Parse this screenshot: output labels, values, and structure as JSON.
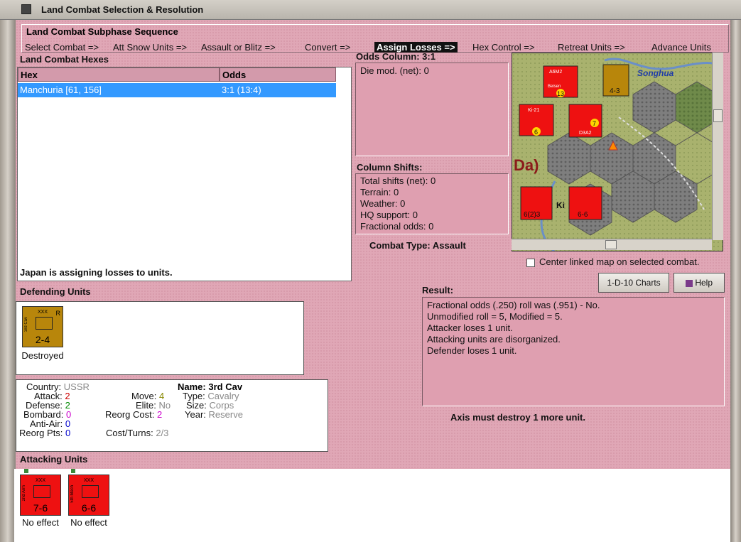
{
  "window": {
    "title": "Land Combat Selection & Resolution"
  },
  "sequence": {
    "title": "Land Combat Subphase Sequence",
    "steps": [
      "Select Combat =>",
      "Att Snow Units =>",
      "Assault or Blitz =>",
      "Convert =>",
      "Assign Losses =>",
      "Hex Control =>",
      "Retreat Units =>",
      "Advance Units"
    ],
    "active_index": 4
  },
  "hexes": {
    "title": "Land Combat Hexes",
    "columns": [
      "Hex",
      "Odds"
    ],
    "rows": [
      {
        "hex": "Manchuria [61, 156]",
        "odds": "3:1 (13:4)"
      }
    ]
  },
  "odds": {
    "title": "Odds Column: 3:1",
    "die_mod": "Die mod. (net): 0"
  },
  "shifts": {
    "title": "Column Shifts:",
    "lines": [
      "Total shifts (net): 0",
      "Terrain: 0",
      "Weather: 0",
      "HQ support: 0",
      "Fractional odds: 0"
    ]
  },
  "combat_type": "Combat Type:  Assault",
  "status_message": "Japan is assigning losses to units.",
  "center_map_label": "Center linked map on selected combat.",
  "buttons": {
    "charts": "1-D-10 Charts",
    "help": "Help"
  },
  "map": {
    "labels": [
      "Songhua",
      "Da)",
      "Ki",
      "D3A2",
      "Ki-21",
      "A6M2",
      "Beisen"
    ],
    "counters": [
      {
        "value": "4-3"
      },
      {
        "value": "6(2)3"
      },
      {
        "value": "6-6"
      }
    ],
    "badges": [
      "13",
      "6",
      "7"
    ]
  },
  "defending": {
    "title": "Defending Units",
    "units": [
      {
        "designation": "3rd Cav",
        "size_mark": "XXX",
        "reserve_mark": "R",
        "value": "2-4",
        "status": "Destroyed",
        "color": "#b8860b"
      }
    ]
  },
  "unit_info": {
    "country_label": "Country:",
    "country": "USSR",
    "attack_label": "Attack:",
    "attack": "2",
    "defense_label": "Defense:",
    "defense": "2",
    "bombard_label": "Bombard:",
    "bombard": "0",
    "antiair_label": "Anti-Air:",
    "antiair": "0",
    "reorgpts_label": "Reorg Pts:",
    "reorgpts": "0",
    "move_label": "Move:",
    "move": "4",
    "elite_label": "Elite:",
    "elite": "No",
    "reorgcost_label": "Reorg Cost:",
    "reorgcost": "2",
    "costturns_label": "Cost/Turns:",
    "costturns": "2/3",
    "name_label": "Name:",
    "name": "3rd Cav",
    "type_label": "Type:",
    "type": "Cavalry",
    "size_label": "Size:",
    "size": "Corps",
    "year_label": "Year:",
    "year": "Reserve"
  },
  "result": {
    "title": "Result:",
    "lines": [
      "Fractional odds (.250) roll was (.951)  - No.",
      "Unmodified roll = 5, Modified = 5.",
      "Attacker loses 1 unit.",
      "Attacking units are disorganized.",
      "Defender loses 1 unit."
    ],
    "footer": "Axis must destroy 1 more unit."
  },
  "attacking": {
    "title": "Attacking Units",
    "units": [
      {
        "designation": "2nd Arm",
        "size_mark": "XXX",
        "value": "7-6",
        "status": "No effect",
        "color": "#ee1111"
      },
      {
        "designation": "5th Mech",
        "size_mark": "XXX",
        "value": "6-6",
        "status": "No effect",
        "color": "#ee1111"
      }
    ]
  },
  "colors": {
    "panel_pink": "#e0a7b6",
    "selection_blue": "#3399ff",
    "attack_red": "#cc0000",
    "defense_green": "#008800",
    "bombard_magenta": "#cc00cc",
    "antiair_blue": "#0000cc",
    "move_olive": "#888800",
    "grey_value": "#888888"
  }
}
